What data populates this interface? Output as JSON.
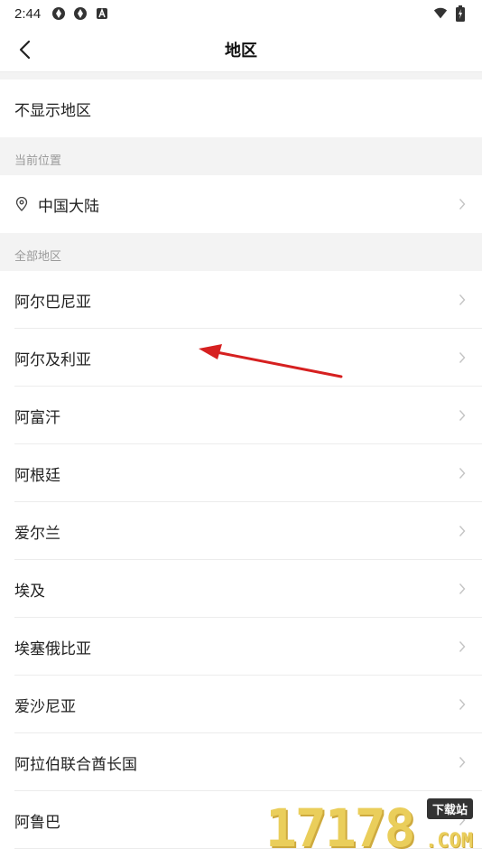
{
  "status_bar": {
    "time": "2:44",
    "left_icons": [
      "sync-icon",
      "sync-icon",
      "a-badge-icon"
    ],
    "right_icons": [
      "wifi-icon",
      "battery-charging-icon"
    ]
  },
  "header": {
    "title": "地区",
    "back_icon": "chevron-left-icon"
  },
  "hide_region": {
    "label": "不显示地区"
  },
  "current_location": {
    "section_title": "当前位置",
    "label": "中国大陆",
    "icon": "location-pin-icon"
  },
  "all_regions": {
    "section_title": "全部地区",
    "items": [
      {
        "label": "阿尔巴尼亚"
      },
      {
        "label": "阿尔及利亚"
      },
      {
        "label": "阿富汗"
      },
      {
        "label": "阿根廷"
      },
      {
        "label": "爱尔兰"
      },
      {
        "label": "埃及"
      },
      {
        "label": "埃塞俄比亚"
      },
      {
        "label": "爱沙尼亚"
      },
      {
        "label": "阿拉伯联合酋长国"
      },
      {
        "label": "阿鲁巴"
      }
    ]
  },
  "watermark": {
    "number": "17178",
    "tag": "下载站",
    "suffix": ".COM"
  },
  "colors": {
    "annotation_arrow": "#d62020",
    "section_bg": "#f3f3f3",
    "chevron": "#c4c4c4"
  }
}
